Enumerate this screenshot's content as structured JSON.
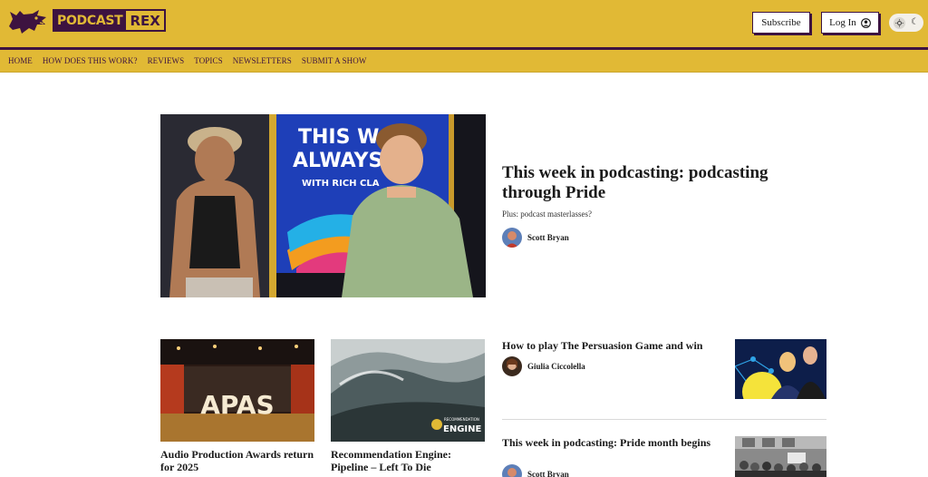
{
  "brand": {
    "logo_text_a": "PODCAST",
    "logo_text_b": "REX"
  },
  "header": {
    "subscribe_label": "Subscribe",
    "login_label": "Log In",
    "theme_toggle": {
      "light_icon": "sun-icon",
      "dark_icon": "moon-icon"
    }
  },
  "nav": {
    "items": [
      {
        "label": "HOME"
      },
      {
        "label": "HOW DOES THIS WORK?"
      },
      {
        "label": "REVIEWS"
      },
      {
        "label": "TOPICS"
      },
      {
        "label": "NEWSLETTERS"
      },
      {
        "label": "SUBMIT A SHOW"
      }
    ]
  },
  "hero": {
    "image_text_line1": "THIS W",
    "image_text_line2": "ALWAYS",
    "image_text_line3": "WITH RICH CLA",
    "title": "This week in podcasting: podcasting through Pride",
    "subtitle": "Plus: podcast masterlasses?",
    "author": "Scott Bryan"
  },
  "cards": [
    {
      "title": "Audio Production Awards return for 2025",
      "image_text": "APAS"
    },
    {
      "title": "Recommendation Engine: Pipeline – Left To Die",
      "image_badge_small": "RECOMMENDATION",
      "image_badge_big": "ENGINE"
    }
  ],
  "list": [
    {
      "title": "How to play The Persuasion Game and win",
      "author": "Giulia Ciccolella"
    },
    {
      "title": "This week in podcasting: Pride month begins",
      "author": "Scott Bryan"
    }
  ],
  "colors": {
    "brand_yellow": "#e1b935",
    "brand_purple": "#3d1340"
  }
}
